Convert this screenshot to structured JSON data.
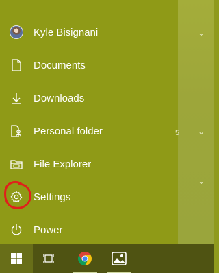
{
  "start_menu": {
    "user": {
      "name": "Kyle Bisignani"
    },
    "items": [
      {
        "id": "documents",
        "label": "Documents",
        "icon": "document-icon"
      },
      {
        "id": "downloads",
        "label": "Downloads",
        "icon": "download-icon"
      },
      {
        "id": "personal-folder",
        "label": "Personal folder",
        "icon": "personal-folder-icon"
      },
      {
        "id": "file-explorer",
        "label": "File Explorer",
        "icon": "file-explorer-icon"
      },
      {
        "id": "settings",
        "label": "Settings",
        "icon": "gear-icon"
      },
      {
        "id": "power",
        "label": "Power",
        "icon": "power-icon"
      }
    ]
  },
  "right_area": {
    "stray_text": "5"
  },
  "colors": {
    "accent": "#8f9a17",
    "taskbar": "#4f5312",
    "annotation": "#e0201b"
  },
  "taskbar": {
    "buttons": [
      "windows-start-icon",
      "task-view-icon",
      "chrome-icon",
      "photos-icon"
    ]
  }
}
